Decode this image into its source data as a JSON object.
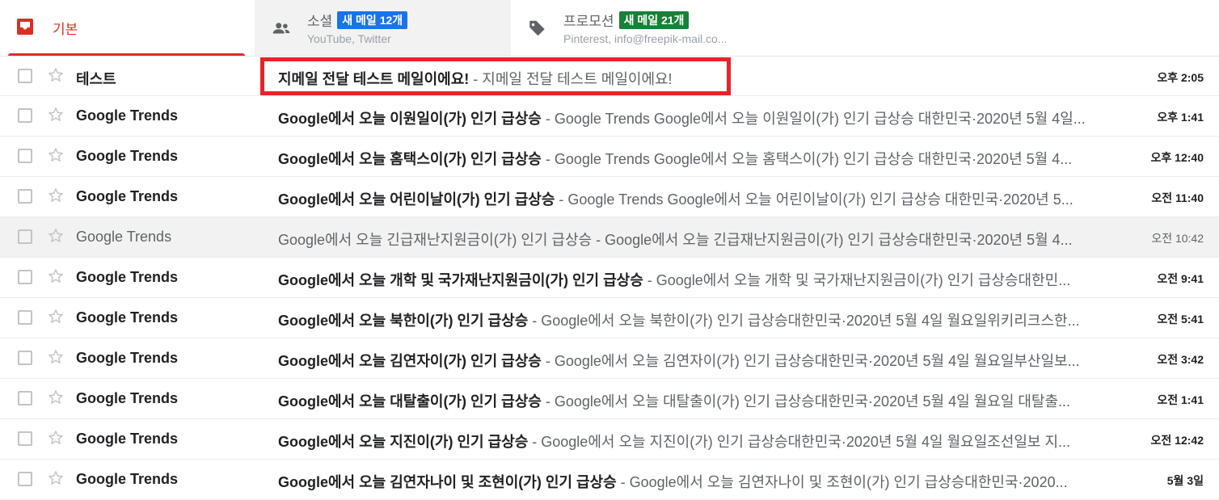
{
  "tabs": {
    "primary": {
      "label": "기본"
    },
    "social": {
      "label": "소셜",
      "badge": "새 메일 12개",
      "sub": "YouTube, Twitter"
    },
    "promotions": {
      "label": "프로모션",
      "badge": "새 메일 21개",
      "sub": "Pinterest, info@freepik-mail.co..."
    }
  },
  "colors": {
    "accent": "#d93025",
    "badge_blue": "#1a73e8",
    "badge_green": "#188038",
    "highlight": "#e8232b"
  },
  "emails": [
    {
      "sender": "테스트",
      "subject": "지메일 전달 테스트 메일이에요!",
      "snippet": " - 지메일 전달 테스트 메일이에요!",
      "date": "오후 2:05",
      "read": false
    },
    {
      "sender": "Google Trends",
      "subject": "Google에서 오늘 이원일이(가) 인기 급상승",
      "snippet": " - Google Trends Google에서 오늘 이원일이(가) 인기 급상승 대한민국·2020년 5월 4일...",
      "date": "오후 1:41",
      "read": false
    },
    {
      "sender": "Google Trends",
      "subject": "Google에서 오늘 홈택스이(가) 인기 급상승",
      "snippet": " - Google Trends Google에서 오늘 홈택스이(가) 인기 급상승 대한민국·2020년 5월 4...",
      "date": "오후 12:40",
      "read": false
    },
    {
      "sender": "Google Trends",
      "subject": "Google에서 오늘 어린이날이(가) 인기 급상승",
      "snippet": " - Google Trends Google에서 오늘 어린이날이(가) 인기 급상승 대한민국·2020년 5...",
      "date": "오전 11:40",
      "read": false
    },
    {
      "sender": "Google Trends",
      "subject": "Google에서 오늘 긴급재난지원금이(가) 인기 급상승",
      "snippet": " - Google에서 오늘 긴급재난지원금이(가) 인기 급상승대한민국·2020년 5월 4...",
      "date": "오전 10:42",
      "read": true
    },
    {
      "sender": "Google Trends",
      "subject": "Google에서 오늘 개학 및 국가재난지원금이(가) 인기 급상승",
      "snippet": " - Google에서 오늘 개학 및 국가재난지원금이(가) 인기 급상승대한민...",
      "date": "오전 9:41",
      "read": false
    },
    {
      "sender": "Google Trends",
      "subject": "Google에서 오늘 북한이(가) 인기 급상승",
      "snippet": " - Google에서 오늘 북한이(가) 인기 급상승대한민국·2020년 5월 4일 월요일위키리크스한...",
      "date": "오전 5:41",
      "read": false
    },
    {
      "sender": "Google Trends",
      "subject": "Google에서 오늘 김연자이(가) 인기 급상승",
      "snippet": " - Google에서 오늘 김연자이(가) 인기 급상승대한민국·2020년 5월 4일 월요일부산일보...",
      "date": "오전 3:42",
      "read": false
    },
    {
      "sender": "Google Trends",
      "subject": "Google에서 오늘 대탈출이(가) 인기 급상승",
      "snippet": " - Google에서 오늘 대탈출이(가) 인기 급상승대한민국·2020년 5월 4일 월요일 대탈출...",
      "date": "오전 1:41",
      "read": false
    },
    {
      "sender": "Google Trends",
      "subject": "Google에서 오늘 지진이(가) 인기 급상승",
      "snippet": " - Google에서 오늘 지진이(가) 인기 급상승대한민국·2020년 5월 4일 월요일조선일보 지...",
      "date": "오전 12:42",
      "read": false
    },
    {
      "sender": "Google Trends",
      "subject": "Google에서 오늘 김연자나이 및 조현이(가) 인기 급상승",
      "snippet": " - Google에서 오늘 김연자나이 및 조현이(가) 인기 급상승대한민국·2020...",
      "date": "5월 3일",
      "read": false
    }
  ]
}
